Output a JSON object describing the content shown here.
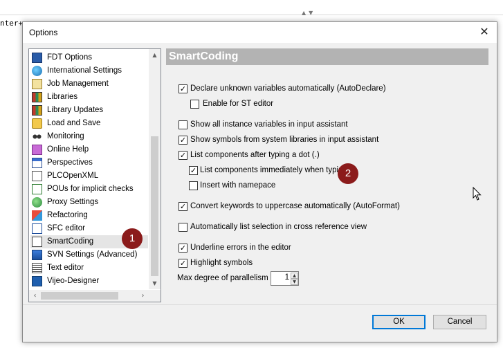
{
  "background": {
    "code_fragment": "nter+"
  },
  "dialog": {
    "title": "Options",
    "close_glyph": "✕"
  },
  "categories": [
    {
      "label": "FDT Options",
      "icon": "fdt-icon"
    },
    {
      "label": "International Settings",
      "icon": "globe-icon"
    },
    {
      "label": "Job Management",
      "icon": "clipboard-icon"
    },
    {
      "label": "Libraries",
      "icon": "books-icon"
    },
    {
      "label": "Library Updates",
      "icon": "books-icon"
    },
    {
      "label": "Load and Save",
      "icon": "folder-icon"
    },
    {
      "label": "Monitoring",
      "icon": "glasses-icon"
    },
    {
      "label": "Online Help",
      "icon": "help-book-icon"
    },
    {
      "label": "Perspectives",
      "icon": "window-icon"
    },
    {
      "label": "PLCOpenXML",
      "icon": "xml-icon"
    },
    {
      "label": "POUs for implicit checks",
      "icon": "pou-icon"
    },
    {
      "label": "Proxy Settings",
      "icon": "network-globe-icon"
    },
    {
      "label": "Refactoring",
      "icon": "refactor-icon"
    },
    {
      "label": "SFC editor",
      "icon": "sfc-icon"
    },
    {
      "label": "SmartCoding",
      "icon": "smartcoding-icon",
      "selected": true
    },
    {
      "label": "SVN Settings (Advanced)",
      "icon": "svn-icon"
    },
    {
      "label": "Text editor",
      "icon": "text-editor-icon"
    },
    {
      "label": "Vijeo-Designer",
      "icon": "vijeo-icon"
    }
  ],
  "annotations": {
    "badge_1": "1",
    "badge_2": "2"
  },
  "panel": {
    "header": "SmartCoding",
    "options": [
      {
        "label": "Declare unknown variables automatically (AutoDeclare)",
        "checked": true
      },
      {
        "label": "Enable for ST editor",
        "checked": false
      },
      {
        "label": "Show all instance variables in input assistant",
        "checked": false
      },
      {
        "label": "Show symbols from system libraries in input assistant",
        "checked": true
      },
      {
        "label": "List components after typing a dot (.)",
        "checked": true
      },
      {
        "label": "List components immediately when typing",
        "checked": true
      },
      {
        "label": "Insert with namepace",
        "checked": false
      },
      {
        "label": "Convert keywords to uppercase automatically (AutoFormat)",
        "checked": true
      },
      {
        "label": "Automatically list selection in cross reference view",
        "checked": false
      },
      {
        "label": "Underline errors in the editor",
        "checked": true
      },
      {
        "label": "Highlight symbols",
        "checked": true
      }
    ],
    "parallelism_label": "Max degree of parallelism",
    "parallelism_value": "1"
  },
  "buttons": {
    "ok": "OK",
    "cancel": "Cancel"
  },
  "colors": {
    "badge": "#8b1b1b",
    "header_bg": "#b3b3b3",
    "ok_border": "#0078d7"
  }
}
